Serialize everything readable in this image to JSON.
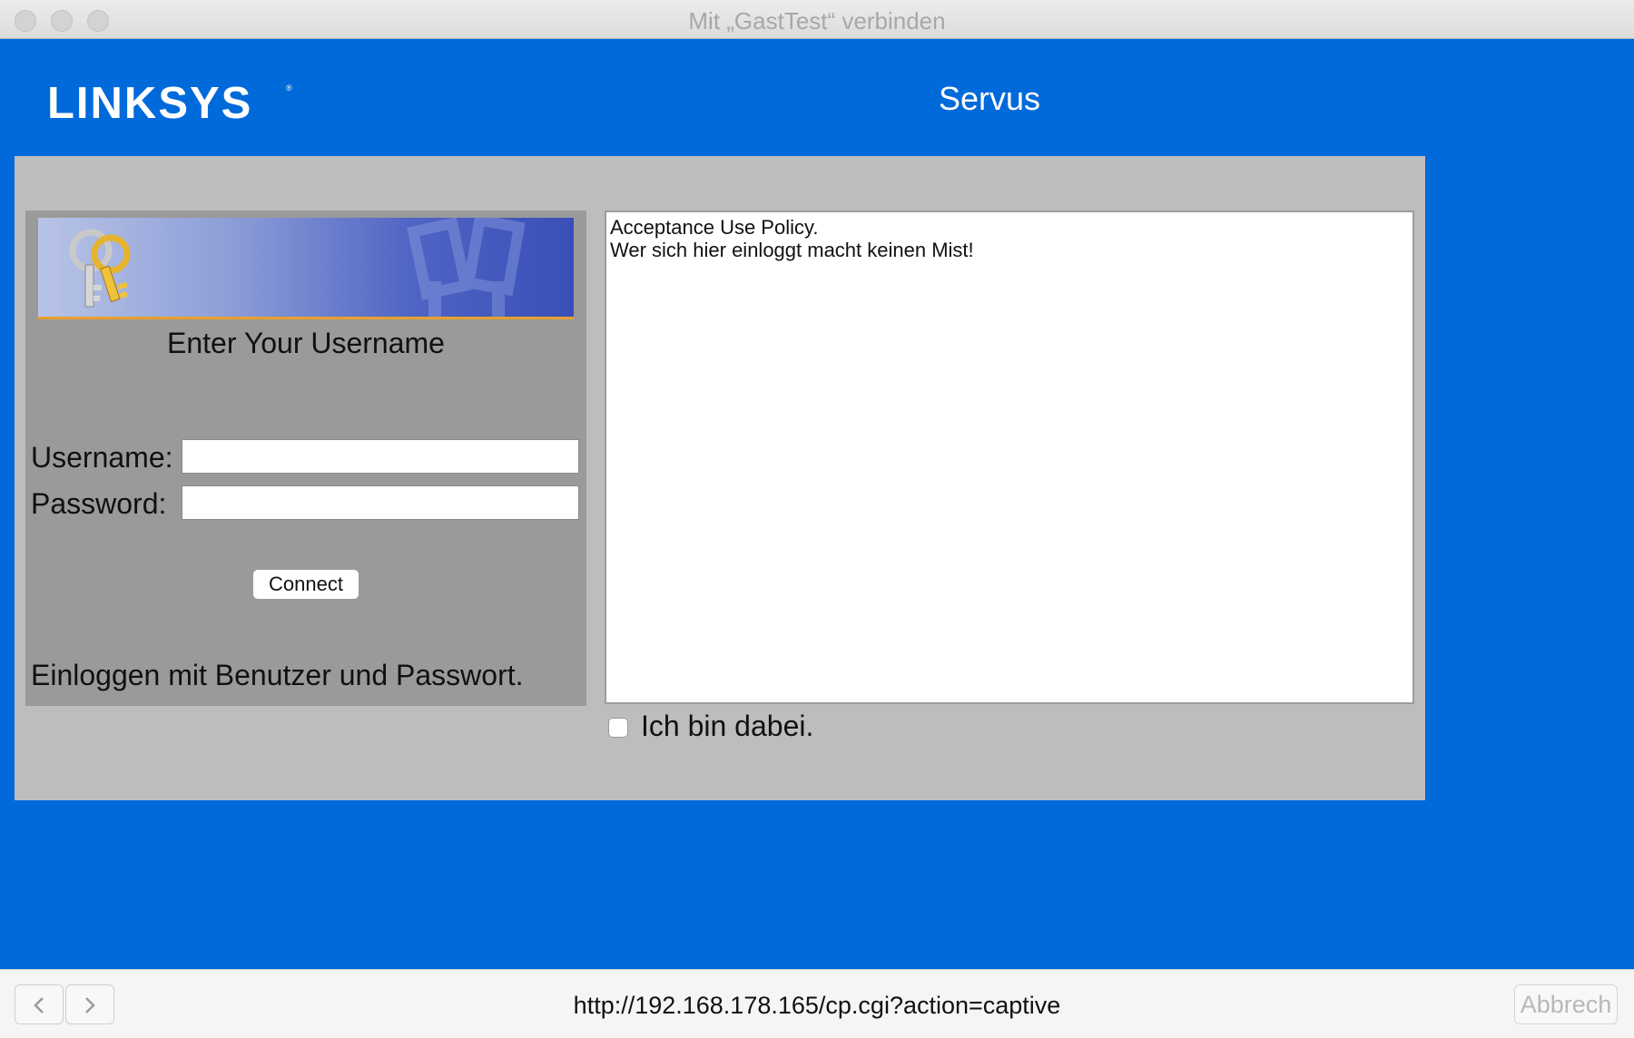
{
  "window": {
    "title": "Mit „GastTest“ verbinden",
    "controls": [
      "close",
      "minimize",
      "zoom"
    ]
  },
  "header": {
    "logo_text": "LINKSYS",
    "title": "Servus"
  },
  "login": {
    "heading": "Enter Your Username",
    "username_label": "Username:",
    "username_value": "",
    "password_label": "Password:",
    "password_value": "",
    "connect_label": "Connect",
    "note": "Einloggen mit Benutzer und Passwort."
  },
  "policy": {
    "lines": [
      "Acceptance Use Policy.",
      "Wer sich hier einloggt macht keinen Mist!"
    ],
    "agree_label": "Ich bin dabei.",
    "agree_checked": false
  },
  "toolbar": {
    "back_icon": "chevron-left-icon",
    "forward_icon": "chevron-right-icon",
    "url": "http://192.168.178.165/cp.cgi?action=captive",
    "cancel_label": "Abbrech"
  },
  "colors": {
    "page_background": "#006ada",
    "panel_background": "#bdbdbd",
    "login_background": "#9a9a9a",
    "banner_accent": "#e8a030"
  }
}
